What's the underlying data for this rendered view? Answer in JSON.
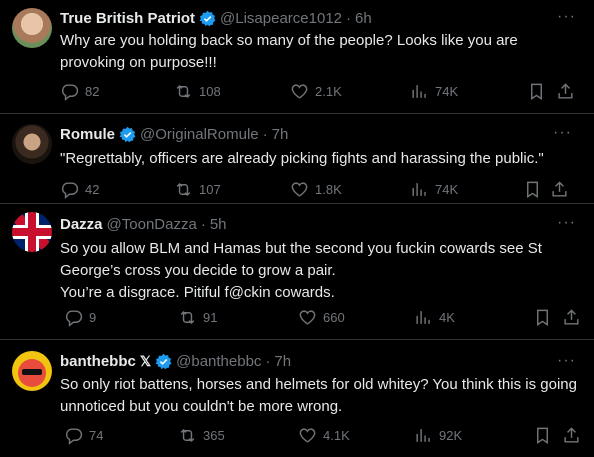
{
  "colors": {
    "background": "#000000",
    "text": "#e7e9ea",
    "muted": "#71767b",
    "verified": "#1d9bf0",
    "divider": "#2f3336"
  },
  "tweets": [
    {
      "name": "True British Patriot",
      "handle": "@Lisapearce1012",
      "time": "6h",
      "text": "Why are you holding back so many of the people? Looks like you are provoking on purpose!!!",
      "replies": "82",
      "reposts": "108",
      "likes": "2.1K",
      "views": "74K",
      "badge": "verified-icon"
    },
    {
      "name": "Romule",
      "handle": "@OriginalRomule",
      "time": "7h",
      "text": "\"Regrettably, officers are already picking fights and harassing the public.\"",
      "replies": "42",
      "reposts": "107",
      "likes": "1.8K",
      "views": "74K",
      "badge": "verified-icon"
    },
    {
      "name": "Dazza",
      "handle": "@ToonDazza",
      "time": "5h",
      "text": "So you allow BLM and Hamas but the second you fuckin cowards see  St George’s cross you decide to grow a pair.\nYou’re a disgrace. Pitiful f@ckin cowards.",
      "replies": "9",
      "reposts": "91",
      "likes": "660",
      "views": "4K"
    },
    {
      "name": "banthebbc",
      "name_suffix": "𝕏",
      "handle": "@banthebbc",
      "time": "7h",
      "text": "So only riot battens, horses and helmets for old whitey? You think this is going unnoticed but you couldn't be more wrong.",
      "replies": "74",
      "reposts": "365",
      "likes": "4.1K",
      "views": "92K",
      "badge": "verified-icon"
    }
  ],
  "dot": "·",
  "more": "···"
}
